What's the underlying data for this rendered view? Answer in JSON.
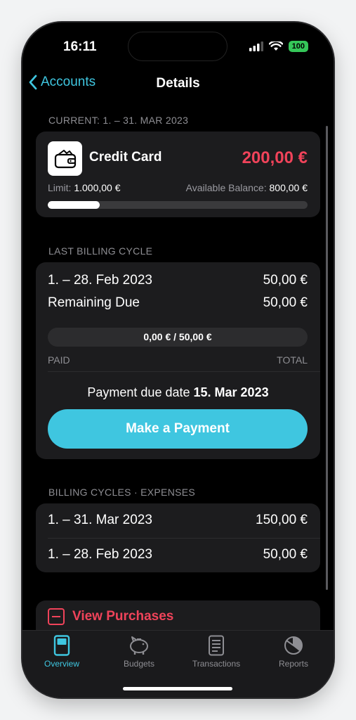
{
  "status": {
    "time": "16:11",
    "battery": "100"
  },
  "nav": {
    "back_label": "Accounts",
    "title": "Details"
  },
  "current": {
    "section_label": "CURRENT: 1. – 31. MAR 2023",
    "account_name": "Credit Card",
    "amount": "200,00 €",
    "limit_label": "Limit:",
    "limit_value": "1.000,00 €",
    "available_label": "Available Balance:",
    "available_value": "800,00 €",
    "usage_fraction": 0.2,
    "accent_color": "#f0435a"
  },
  "last_cycle": {
    "section_label": "LAST BILLING CYCLE",
    "period": "1. – 28. Feb 2023",
    "period_amount": "50,00 €",
    "remaining_label": "Remaining Due",
    "remaining_amount": "50,00 €",
    "progress_text": "0,00 € / 50,00 €",
    "paid_label": "PAID",
    "total_label": "TOTAL",
    "due_prefix": "Payment due date",
    "due_date": "15. Mar 2023",
    "pay_button": "Make a Payment",
    "button_color": "#3fc6e0"
  },
  "cycles": {
    "section_label": "BILLING CYCLES  ·  EXPENSES",
    "rows": [
      {
        "period": "1. – 31. Mar 2023",
        "amount": "150,00 €"
      },
      {
        "period": "1. – 28. Feb 2023",
        "amount": "50,00 €"
      }
    ]
  },
  "purchases": {
    "label": "View Purchases",
    "icon": "minus-square-icon"
  },
  "tabs": [
    {
      "label": "Overview",
      "icon": "card-icon",
      "active": true
    },
    {
      "label": "Budgets",
      "icon": "piggy-bank-icon",
      "active": false
    },
    {
      "label": "Transactions",
      "icon": "receipt-icon",
      "active": false
    },
    {
      "label": "Reports",
      "icon": "pie-chart-icon",
      "active": false
    }
  ]
}
